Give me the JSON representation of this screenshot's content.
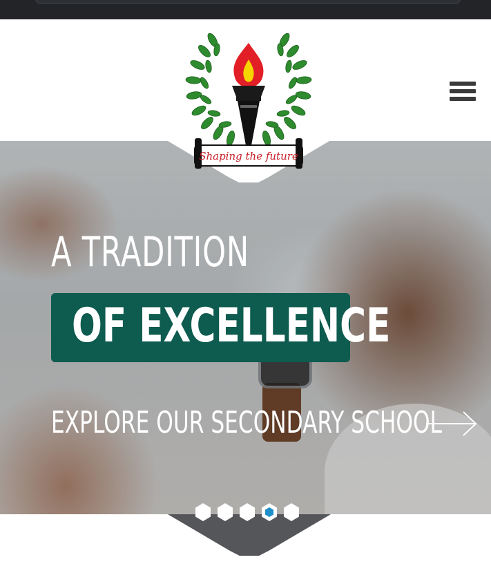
{
  "brand": {
    "logo_motto": "Shaping the future"
  },
  "hero": {
    "headline_line1": "A TRADITION",
    "headline_line2": "OF EXCELLENCE",
    "cta_label": "EXPLORE OUR SECONDARY SCHOOL"
  },
  "carousel": {
    "slide_count": 5,
    "active_index": 3
  },
  "colors": {
    "accent_green": "#0e5b4f",
    "active_dot": "#1f8fc9",
    "inactive_dot": "#ffffff",
    "topbar": "#222427"
  },
  "icons": {
    "menu": "hamburger-icon",
    "cta": "arrow-right-icon",
    "logo": "torch-laurel-emblem"
  }
}
